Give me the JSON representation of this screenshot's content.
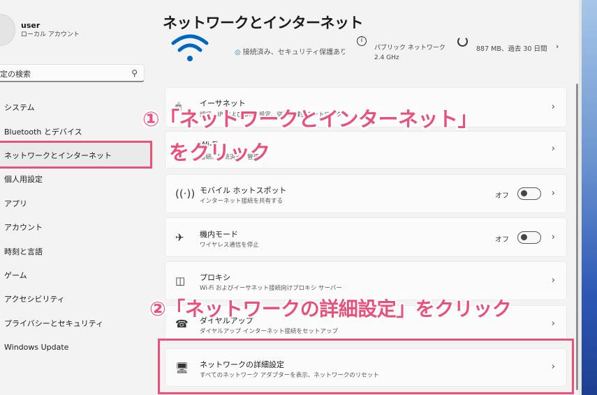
{
  "user": {
    "name": "user",
    "account_type": "ローカル アカウント"
  },
  "search": {
    "placeholder": "定の検索"
  },
  "sidebar": {
    "items": [
      {
        "label": "システム"
      },
      {
        "label": "Bluetooth とデバイス"
      },
      {
        "label": "ネットワークとインターネット"
      },
      {
        "label": "個人用設定"
      },
      {
        "label": "アプリ"
      },
      {
        "label": "アカウント"
      },
      {
        "label": "時刻と言語"
      },
      {
        "label": "ゲーム"
      },
      {
        "label": "アクセシビリティ"
      },
      {
        "label": "プライバシーとセキュリティ"
      },
      {
        "label": "Windows Update"
      }
    ]
  },
  "main": {
    "title": "ネットワークとインターネット",
    "status": {
      "connection": "接続済み、セキュリティ保護あり",
      "network_kind": "パブリック ネットワーク",
      "band": "2.4 GHz",
      "usage": "887 MB、過去 30 日間"
    },
    "cards": [
      {
        "title": "イーサネット",
        "subtitle": "認証、IP および DNS 設定、従量制課金ネットワーク",
        "icon": "ethernet-icon"
      },
      {
        "title": "Wi-Fi",
        "subtitle": "接続、接続済み、管理",
        "icon": "wifi-icon"
      },
      {
        "title": "モバイル ホットスポット",
        "subtitle": "インターネット接続を共有する",
        "toggle_label": "オフ",
        "icon": "hotspot-icon"
      },
      {
        "title": "機内モード",
        "subtitle": "ワイヤレス通信を停止",
        "toggle_label": "オフ",
        "icon": "airplane-icon"
      },
      {
        "title": "プロキシ",
        "subtitle": "Wi-Fi およびイーサネット接続向けプロキシ サーバー",
        "icon": "proxy-icon"
      },
      {
        "title": "ダイヤルアップ",
        "subtitle": "ダイヤルアップ インターネット接続をセットアップ",
        "icon": "dialup-icon"
      },
      {
        "title": "ネットワークの詳細設定",
        "subtitle": "すべてのネットワーク アダプターを表示、ネットワークのリセット",
        "icon": "advanced-network-icon"
      }
    ]
  },
  "annotations": {
    "step1_line1": "①「ネットワークとインターネット」",
    "step1_line2": "をクリック",
    "step2": "②「ネットワークの詳細設定」をクリック"
  },
  "colors": {
    "highlight": "#e8517a",
    "wifi": "#0067c0"
  }
}
